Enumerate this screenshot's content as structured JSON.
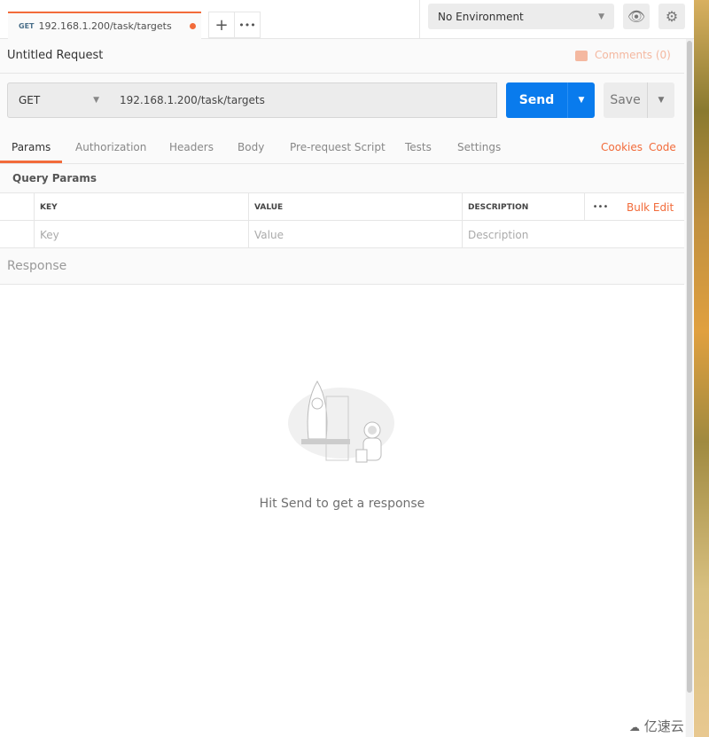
{
  "tab": {
    "method": "GET",
    "title": "192.168.1.200/task/targets",
    "new_tab": "+",
    "more": "•••"
  },
  "environment": {
    "selected": "No Environment"
  },
  "request": {
    "name": "Untitled Request",
    "comments": "Comments (0)",
    "method": "GET",
    "url": "192.168.1.200/task/targets",
    "send": "Send",
    "save": "Save"
  },
  "subtabs": [
    {
      "label": "Params"
    },
    {
      "label": "Authorization"
    },
    {
      "label": "Headers"
    },
    {
      "label": "Body"
    },
    {
      "label": "Pre-request Script"
    },
    {
      "label": "Tests"
    },
    {
      "label": "Settings"
    }
  ],
  "links": {
    "cookies": "Cookies",
    "code": "Code"
  },
  "params": {
    "title": "Query Params",
    "headers": [
      "KEY",
      "VALUE",
      "DESCRIPTION"
    ],
    "more": "•••",
    "bulk_edit": "Bulk Edit",
    "placeholders": [
      "Key",
      "Value",
      "Description"
    ]
  },
  "response": {
    "title": "Response",
    "empty": "Hit Send to get a response"
  },
  "watermark": "亿速云",
  "colors": {
    "accent": "#f26b3a",
    "send": "#097bed"
  }
}
